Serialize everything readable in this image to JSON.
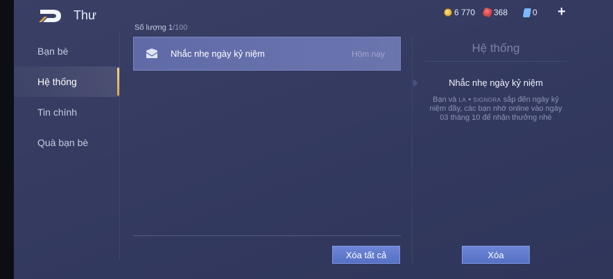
{
  "header": {
    "title": "Thư",
    "currencies": [
      {
        "icon": "gold-coin-icon",
        "value": "6 770"
      },
      {
        "icon": "ruby-icon",
        "value": "368"
      },
      {
        "icon": "voucher-icon",
        "value": "0"
      }
    ],
    "plus_label": "+"
  },
  "sidebar": {
    "items": [
      {
        "label": "Bạn bè",
        "active": false
      },
      {
        "label": "Hệ thống",
        "active": true
      },
      {
        "label": "Tin chính",
        "active": false
      },
      {
        "label": "Quà bạn bè",
        "active": false
      }
    ]
  },
  "mail_list": {
    "count_label": "Số lượng 1",
    "count_total": "/100",
    "items": [
      {
        "subject": "Nhắc nhẹ ngày kỷ niệm",
        "time": "Hôm nay"
      }
    ],
    "delete_all_label": "Xóa tất cả"
  },
  "detail": {
    "heading": "Hệ thống",
    "title": "Nhắc nhẹ ngày kỷ niệm",
    "body_prefix": "Bạn và ",
    "body_name_1": "LA",
    "body_sep": " • ",
    "body_name_2": "SIGNORA",
    "body_suffix": " sắp đến ngày kỷ niệm đầy, các bạn nhớ online vào ngày 03 tháng 10 để nhận thưởng nhé",
    "delete_label": "Xóa"
  },
  "colors": {
    "accent": "#d8a64a",
    "button": "#5f78cc",
    "selected_mail": "#636eaa"
  }
}
